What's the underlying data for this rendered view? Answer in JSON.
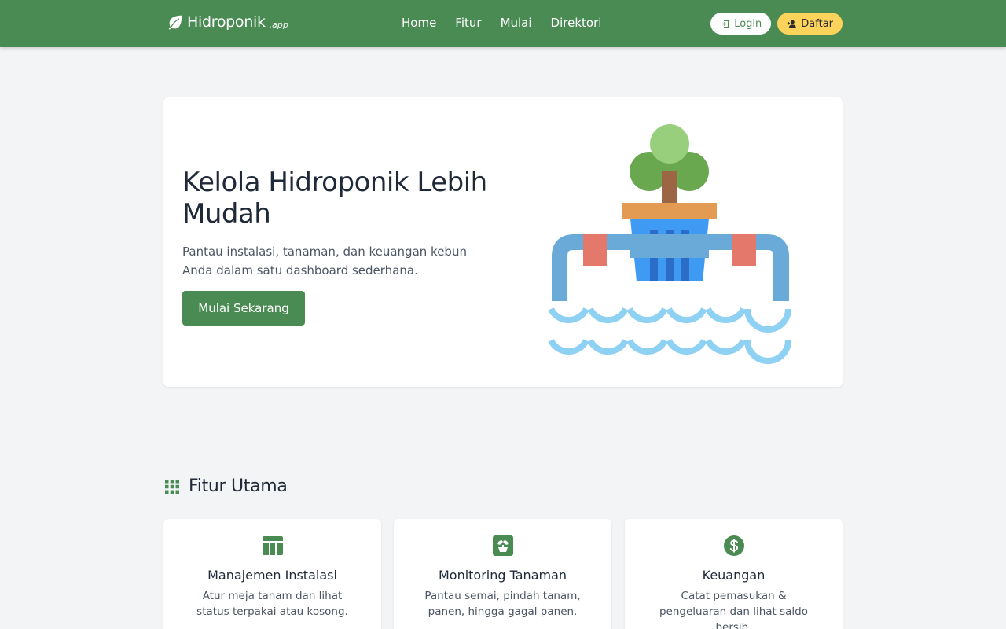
{
  "navbar": {
    "brand": {
      "name": "Hidroponik",
      "suffix": ".app",
      "icon": "leaf-icon"
    },
    "links": [
      {
        "label": "Home"
      },
      {
        "label": "Fitur"
      },
      {
        "label": "Mulai"
      },
      {
        "label": "Direktori"
      }
    ],
    "login_label": "Login",
    "register_label": "Daftar",
    "color": "#4a8b54"
  },
  "hero": {
    "title": "Kelola Hidroponik Lebih Mudah",
    "subtitle": "Pantau instalasi, tanaman, dan keuangan kebun Anda dalam satu dashboard sederhana.",
    "cta_label": "Mulai Sekarang"
  },
  "features": {
    "heading": "Fitur Utama",
    "heading_icon": "grid-icon",
    "items": [
      {
        "icon": "table-icon",
        "title": "Manajemen Instalasi",
        "desc": "Atur meja tanam dan lihat status terpakai atau kosong."
      },
      {
        "icon": "plant-icon",
        "title": "Monitoring Tanaman",
        "desc": "Pantau semai, pindah tanam, panen, hingga gagal panen."
      },
      {
        "icon": "dollar-icon",
        "title": "Keuangan",
        "desc": "Catat pemasukan & pengeluaran dan lihat saldo bersih."
      }
    ]
  },
  "colors": {
    "primary": "#4a8b54",
    "accent": "#fdd35c",
    "background": "#f3f4f6"
  }
}
